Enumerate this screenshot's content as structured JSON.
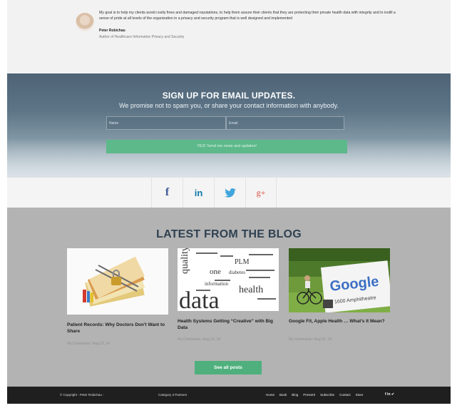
{
  "testimonial": {
    "quote": "My goal is to help my clients avoid costly fines and damaged reputations, to help them assure their clients that they are protecting their private health data with integrity and to instill a sense of pride at all levels of the organization in a privacy and security program that is well designed and implemented",
    "author_name": "Peter Robichau",
    "author_title": "Author of Healthcare Information Privacy and Security"
  },
  "signup": {
    "title": "SIGN UP FOR EMAIL UPDATES.",
    "subtitle": "We promise not to spam you, or share your contact information with anybody.",
    "name_placeholder": "Name",
    "email_placeholder": "Email",
    "button_label": "YES! Send me news and updates!"
  },
  "social": {
    "facebook": "f",
    "linkedin": "in",
    "google_plus": "g+"
  },
  "blog": {
    "heading": "LATEST FROM THE BLOG",
    "posts": [
      {
        "title": "Patient Records: Why Doctors Don't Want to Share",
        "meta": "No Comments / Aug 22, 14"
      },
      {
        "title": "Health Systems Getting “Creative” with Big Data",
        "meta": "No Comments / Aug 22, 14"
      },
      {
        "title": "Google Fit, Apple Health … What’s It Mean?",
        "meta": "No Comments / Aug 22, 14"
      }
    ],
    "thumb2_words": {
      "big": "data",
      "health": "health",
      "quality": "quality",
      "plm": "PLM",
      "one": "one",
      "diabetes": "diabetes",
      "information": "information"
    },
    "thumb3_words": {
      "google": "Google",
      "address": "1600 Amphitheatre"
    },
    "see_all_label": "See all posts"
  },
  "footer": {
    "copyright": "© Copyright - Peter Robichau -",
    "category": "Category 3 Partners",
    "nav": [
      "Home",
      "Book",
      "Blog",
      "PressKit",
      "Subscribe",
      "Contact",
      "Store"
    ],
    "social": "f in ✔"
  },
  "colors": {
    "accent_green": "#4fb07d",
    "blog_heading": "#2f4151",
    "footer_bg": "#1f1f1f"
  }
}
